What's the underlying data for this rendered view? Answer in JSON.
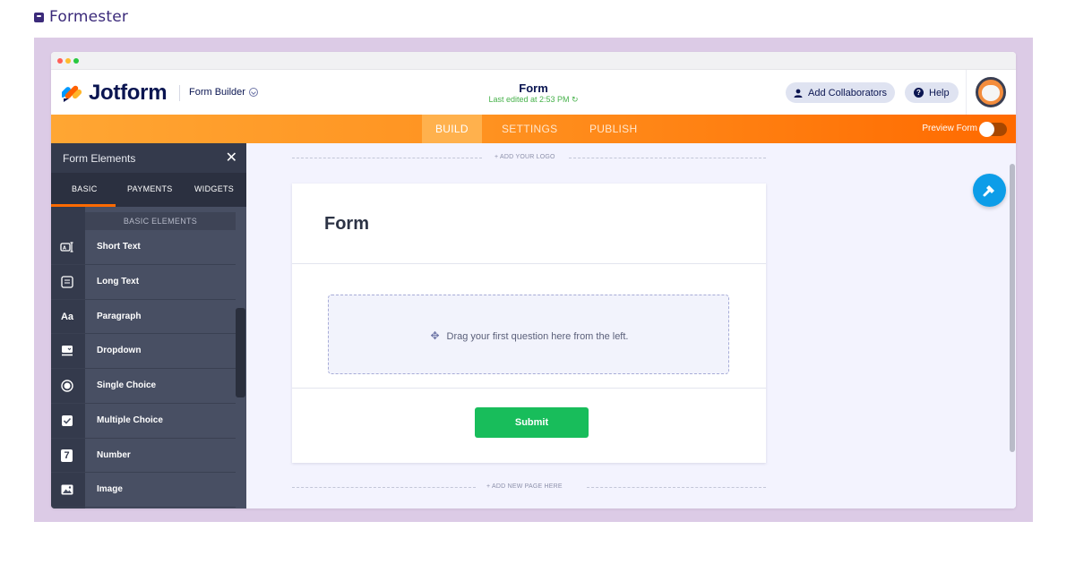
{
  "site": {
    "name": "Formester"
  },
  "app": {
    "logo_text": "Jotform",
    "builder_label": "Form Builder",
    "form_name": "Form",
    "last_edited": "Last edited at 2:53 PM",
    "add_collaborators_label": "Add Collaborators",
    "help_label": "Help"
  },
  "tabs": [
    {
      "label": "BUILD",
      "active": true
    },
    {
      "label": "SETTINGS",
      "active": false
    },
    {
      "label": "PUBLISH",
      "active": false
    }
  ],
  "preview": {
    "label": "Preview Form",
    "enabled": false
  },
  "sidebar": {
    "title": "Form Elements",
    "tabs": [
      "BASIC",
      "PAYMENTS",
      "WIDGETS"
    ],
    "section_label": "BASIC ELEMENTS",
    "items": [
      {
        "label": "Short Text",
        "icon": "short-text-icon"
      },
      {
        "label": "Long Text",
        "icon": "long-text-icon"
      },
      {
        "label": "Paragraph",
        "icon": "paragraph-icon",
        "glyph": "Aa"
      },
      {
        "label": "Dropdown",
        "icon": "dropdown-icon"
      },
      {
        "label": "Single Choice",
        "icon": "single-choice-icon"
      },
      {
        "label": "Multiple Choice",
        "icon": "multiple-choice-icon"
      },
      {
        "label": "Number",
        "icon": "number-icon",
        "glyph": "7"
      },
      {
        "label": "Image",
        "icon": "image-icon"
      }
    ]
  },
  "canvas": {
    "add_logo_label": "+ ADD YOUR LOGO",
    "form_title": "Form",
    "drop_hint": "Drag your first question here from the left.",
    "submit_label": "Submit",
    "add_page_label": "+ ADD NEW PAGE HERE"
  },
  "colors": {
    "accent_orange": "#ff6a00",
    "brand_navy": "#0a1551",
    "submit_green": "#18bd5b",
    "frame_lilac": "#dccbe6"
  }
}
